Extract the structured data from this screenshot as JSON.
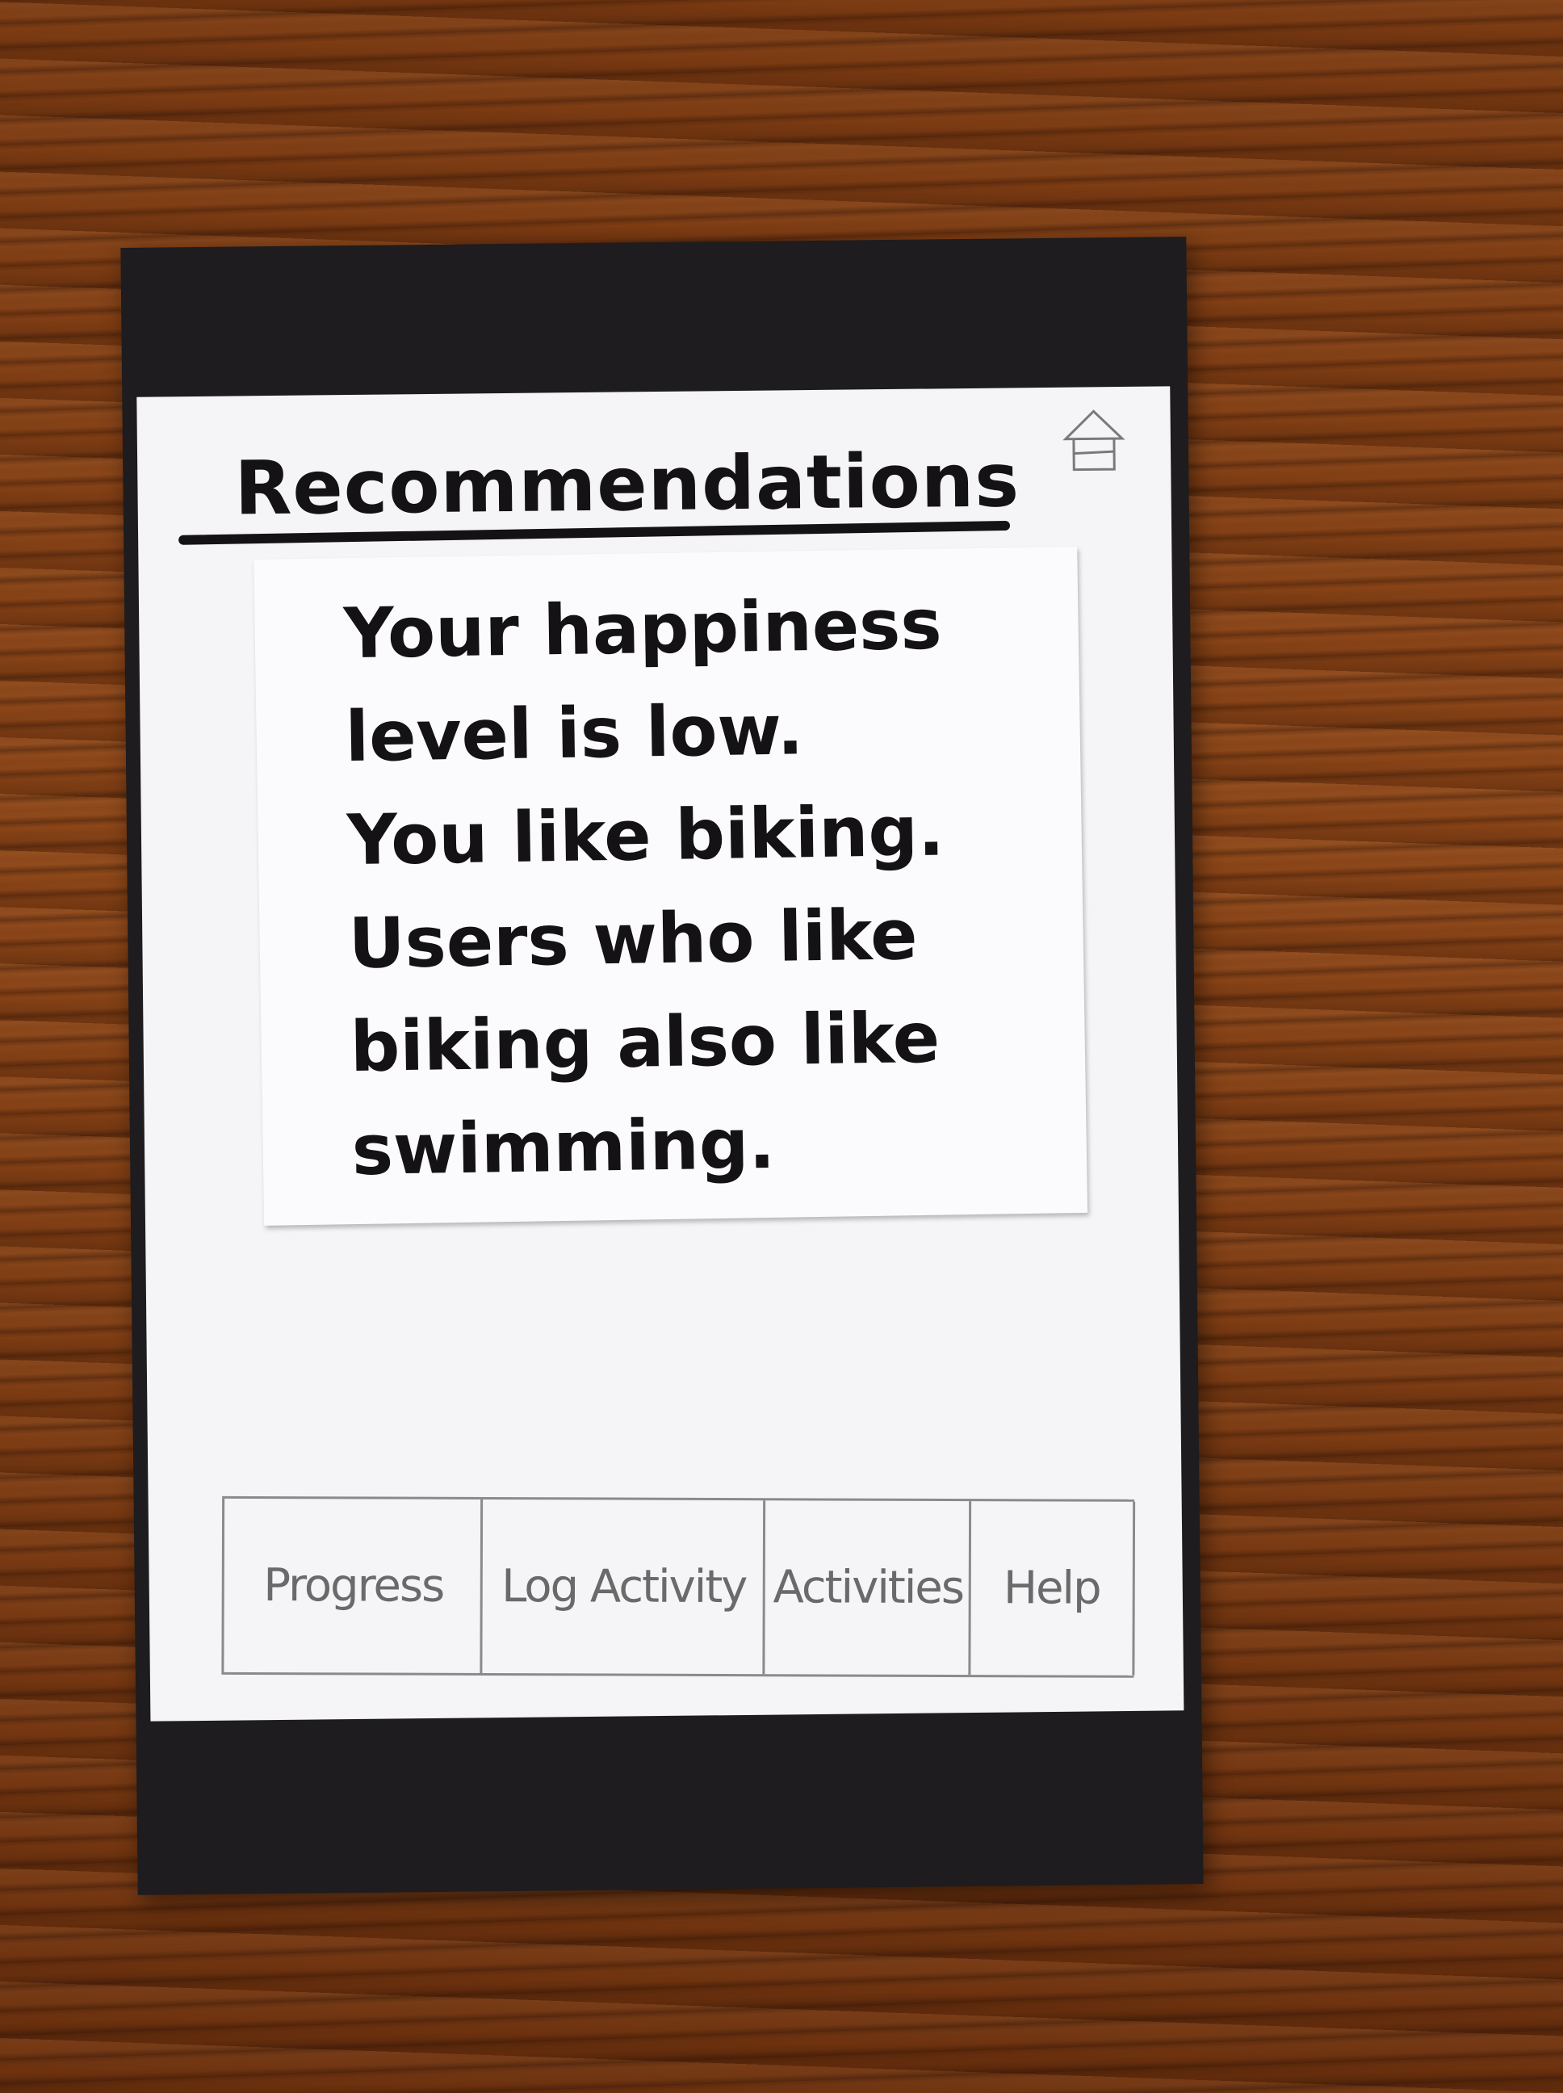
{
  "screen": {
    "title": "Recommendations",
    "home_icon": "home-icon",
    "message": "Your happiness\nlevel is low.\nYou like biking.\nUsers who like\nbiking also like\nswimming."
  },
  "tabbar": {
    "tabs": [
      {
        "label": "Progress"
      },
      {
        "label": "Log Activity"
      },
      {
        "label": "Activities"
      },
      {
        "label": "Help"
      }
    ]
  },
  "colors": {
    "ink": "#141214",
    "pencil": "#6a6a6a",
    "paper": "#f5f5f7",
    "frame": "#1e1c1e"
  }
}
